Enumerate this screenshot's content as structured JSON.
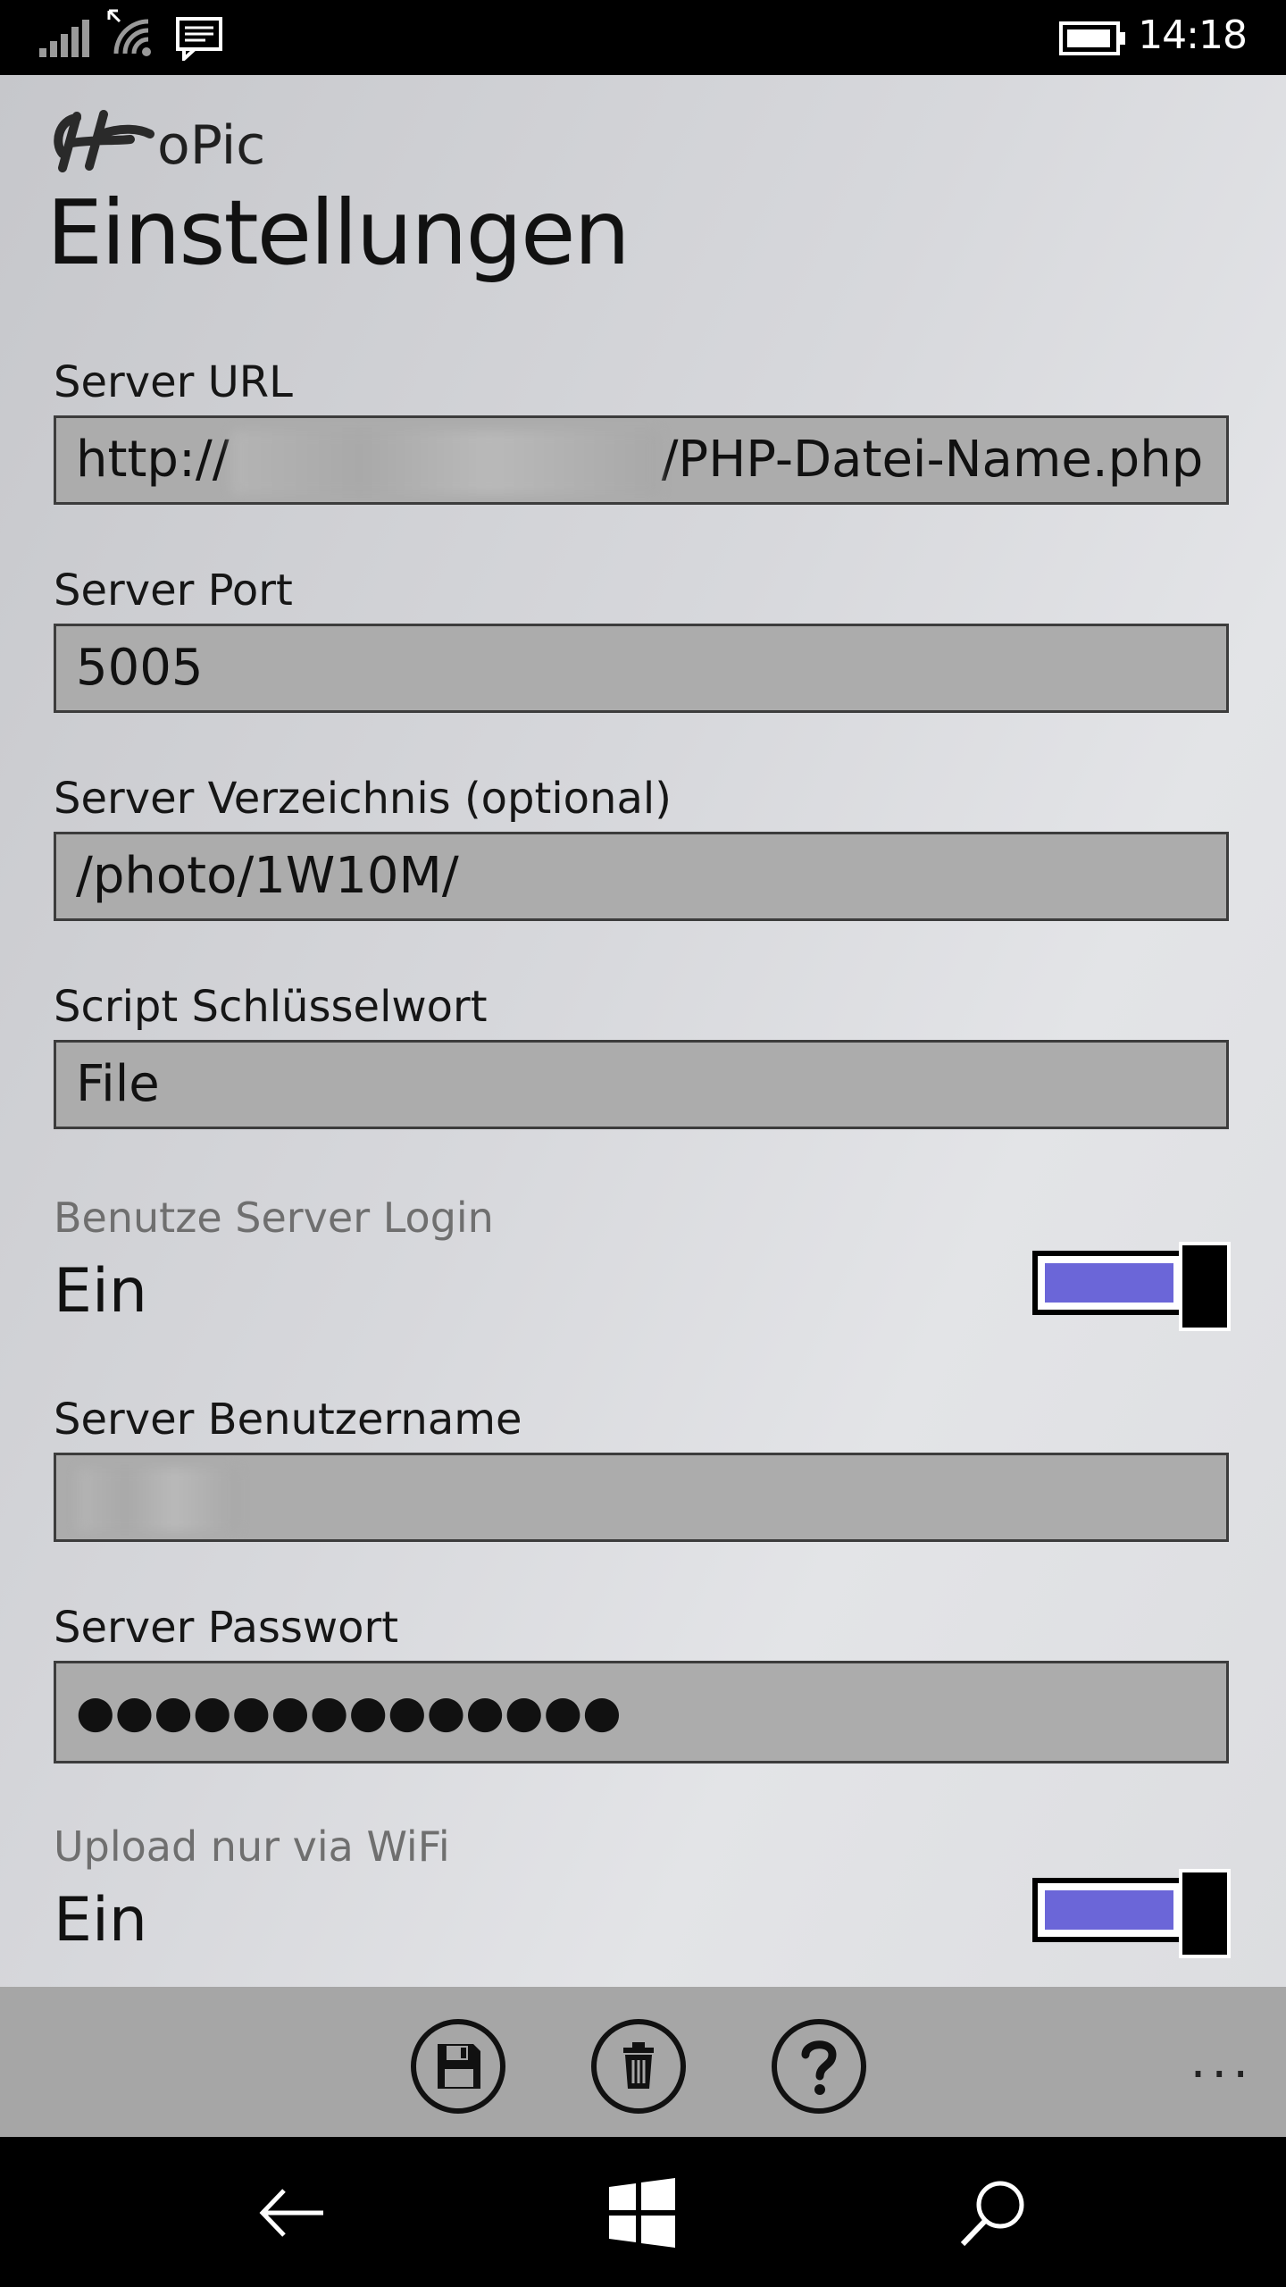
{
  "status_bar": {
    "time": "14:18",
    "icons": [
      "signal-icon",
      "wifi-icon",
      "message-icon",
      "battery-icon"
    ]
  },
  "app": {
    "logo_suffix": "oPic",
    "page_title": "Einstellungen"
  },
  "fields": {
    "server_url": {
      "label": "Server URL",
      "value_prefix": "http://",
      "value_suffix": "/PHP-Datei-Name.php"
    },
    "server_port": {
      "label": "Server Port",
      "value": "5005"
    },
    "server_dir": {
      "label": "Server Verzeichnis (optional)",
      "value": "/photo/1W10M/"
    },
    "script_keyword": {
      "label": "Script Schlüsselwort",
      "value": "File"
    },
    "server_username": {
      "label": "Server Benutzername"
    },
    "server_password": {
      "label": "Server Passwort",
      "value": "●●●●●●●●●●●●●●"
    }
  },
  "toggles": {
    "server_login": {
      "label": "Benutze Server Login",
      "state": "Ein",
      "on": true
    },
    "wifi_only": {
      "label": "Upload nur via WiFi",
      "state": "Ein",
      "on": true
    }
  },
  "app_bar": {
    "buttons": [
      "save-icon",
      "delete-icon",
      "help-icon"
    ],
    "more": "..."
  },
  "nav_bar": {
    "buttons": [
      "back-icon",
      "windows-icon",
      "search-icon"
    ]
  },
  "colors": {
    "toggle_fill": "#6b66d8",
    "field_bg": "#acacac",
    "app_bar_bg": "#a6a6a6"
  }
}
